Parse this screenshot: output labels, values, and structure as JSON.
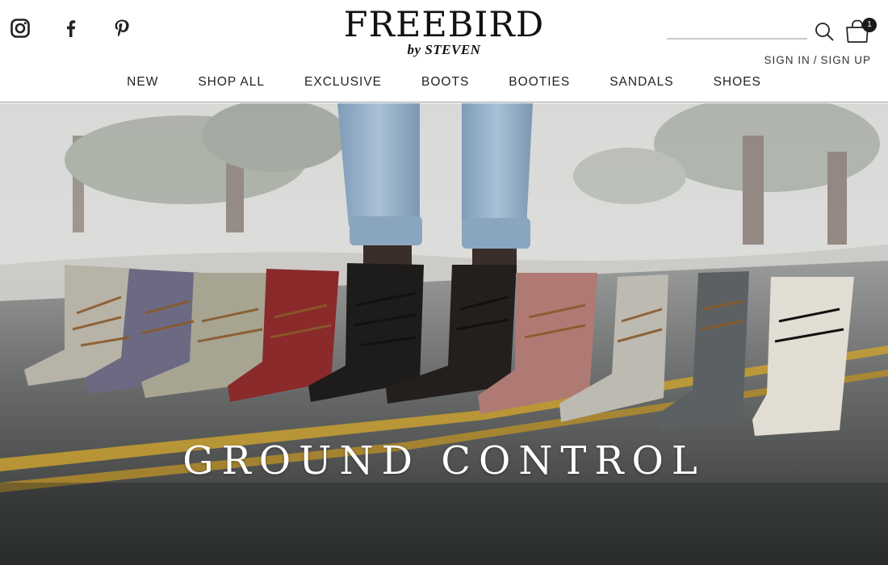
{
  "brand": {
    "name": "FREEBIRD",
    "sub": "by STEVEN"
  },
  "social": [
    {
      "name": "instagram-icon"
    },
    {
      "name": "facebook-icon"
    },
    {
      "name": "pinterest-icon"
    }
  ],
  "search": {
    "placeholder": "",
    "value": ""
  },
  "cart": {
    "count": "1"
  },
  "account": {
    "sign_in": "SIGN IN",
    "separator": "/",
    "sign_up": "SIGN UP"
  },
  "nav": {
    "items": [
      {
        "label": "NEW"
      },
      {
        "label": "SHOP ALL"
      },
      {
        "label": "EXCLUSIVE"
      },
      {
        "label": "BOOTS"
      },
      {
        "label": "BOOTIES"
      },
      {
        "label": "SANDALS"
      },
      {
        "label": "SHOES"
      }
    ]
  },
  "hero": {
    "title": "GROUND CONTROL"
  },
  "colors": {
    "text": "#222222",
    "badge": "#1a1a1a",
    "road_line": "#c9a030",
    "hero_text": "#ffffff"
  }
}
